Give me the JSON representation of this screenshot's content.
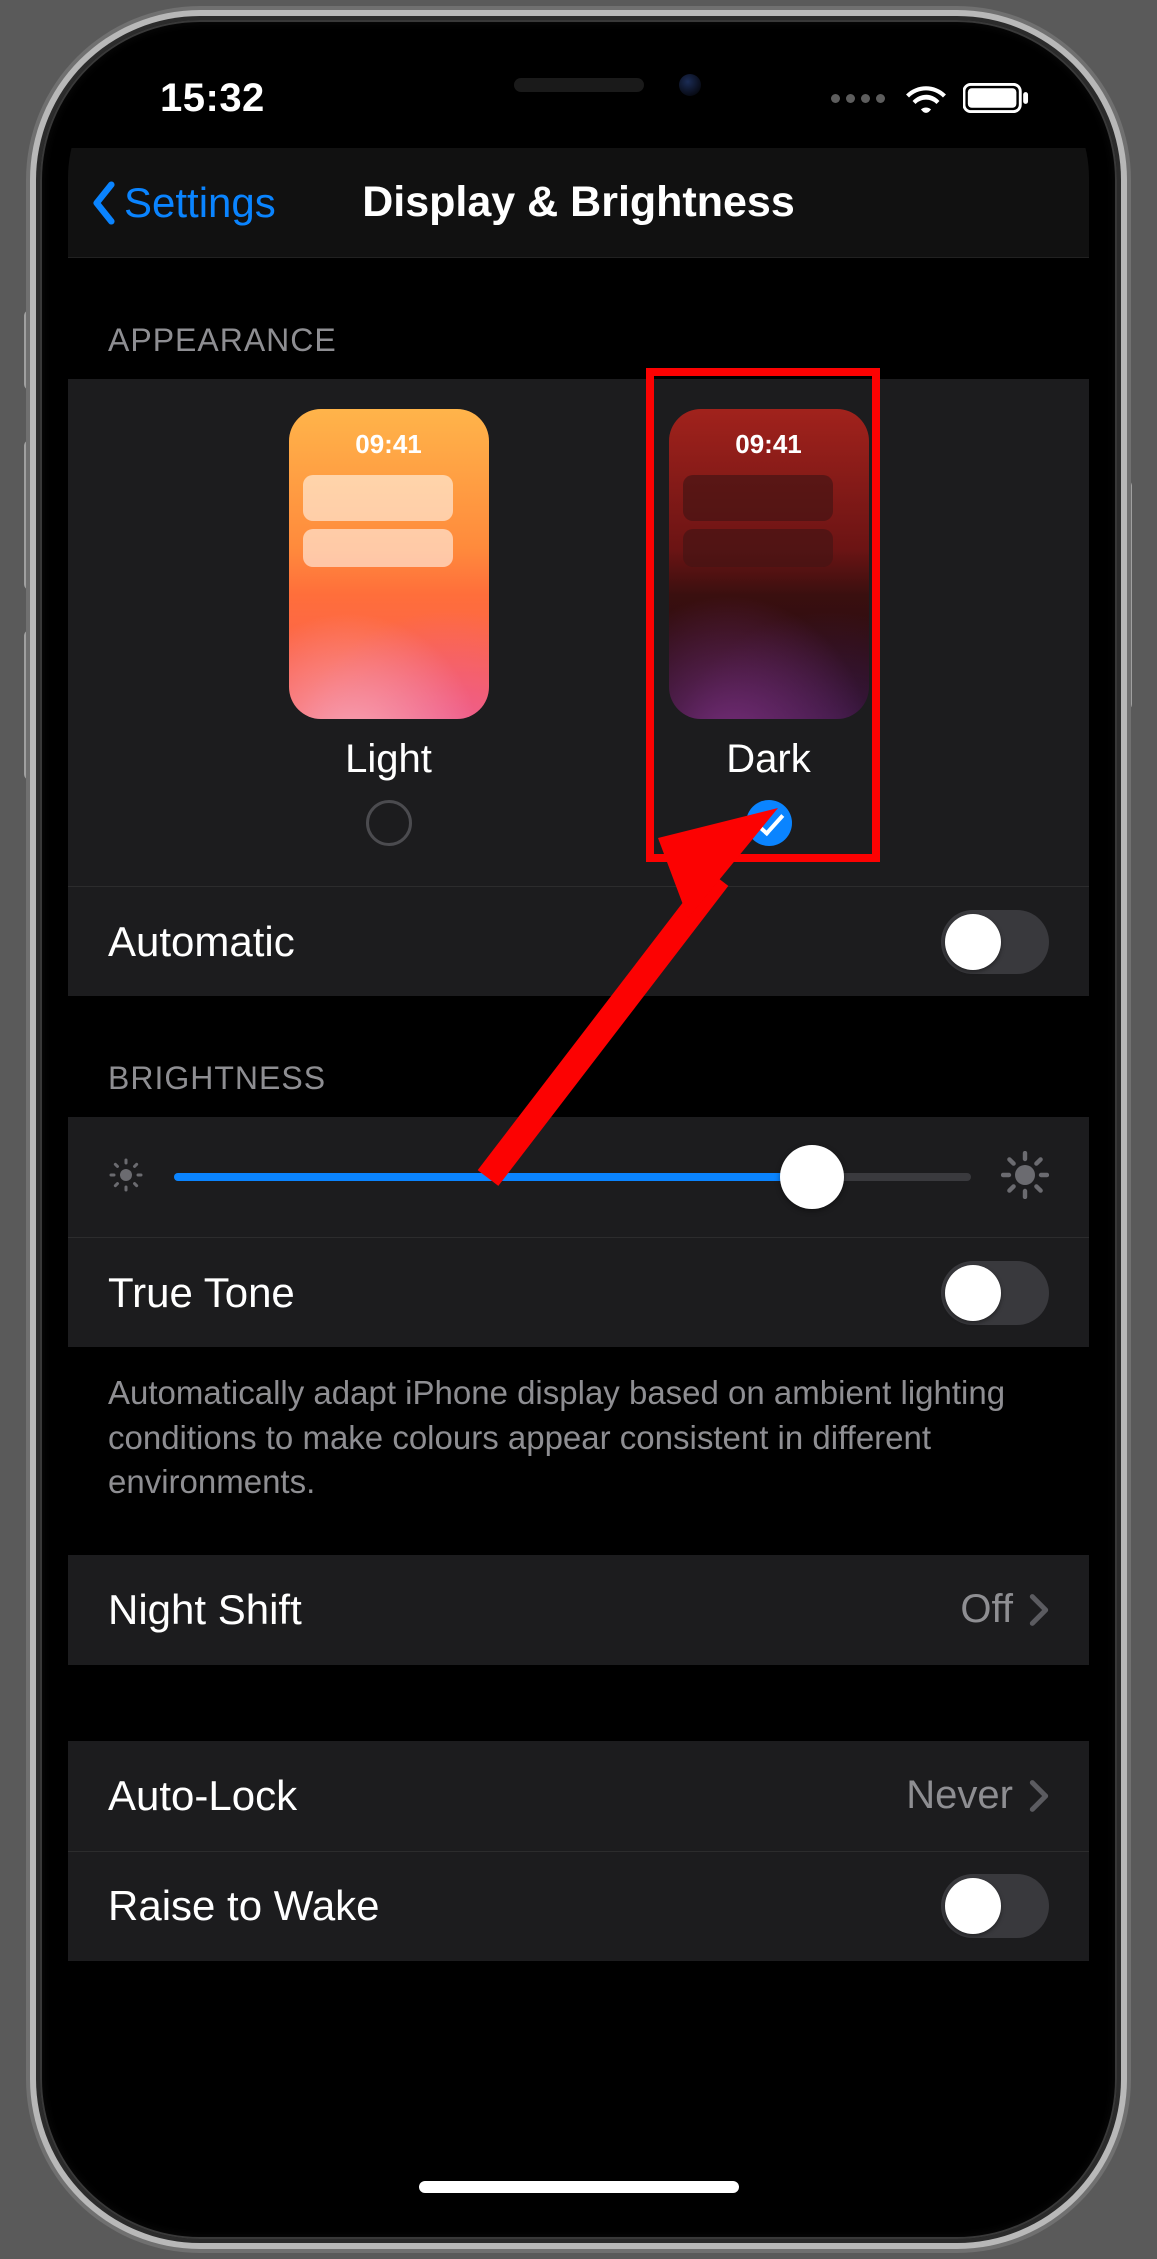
{
  "status": {
    "time": "15:32"
  },
  "nav": {
    "back_label": "Settings",
    "title": "Display & Brightness"
  },
  "appearance": {
    "header": "APPEARANCE",
    "preview_time": "09:41",
    "options": [
      {
        "label": "Light",
        "selected": false
      },
      {
        "label": "Dark",
        "selected": true
      }
    ],
    "automatic_label": "Automatic",
    "automatic_on": false
  },
  "brightness": {
    "header": "BRIGHTNESS",
    "value_percent": 80,
    "truetone_label": "True Tone",
    "truetone_on": false,
    "truetone_footer": "Automatically adapt iPhone display based on ambient lighting conditions to make colours appear consistent in different environments."
  },
  "night_shift": {
    "label": "Night Shift",
    "value": "Off"
  },
  "auto_lock": {
    "label": "Auto-Lock",
    "value": "Never"
  },
  "raise_to_wake": {
    "label": "Raise to Wake",
    "on": false
  },
  "annotation": {
    "highlight": "dark-option",
    "arrow_target": "dark-option-radio"
  }
}
